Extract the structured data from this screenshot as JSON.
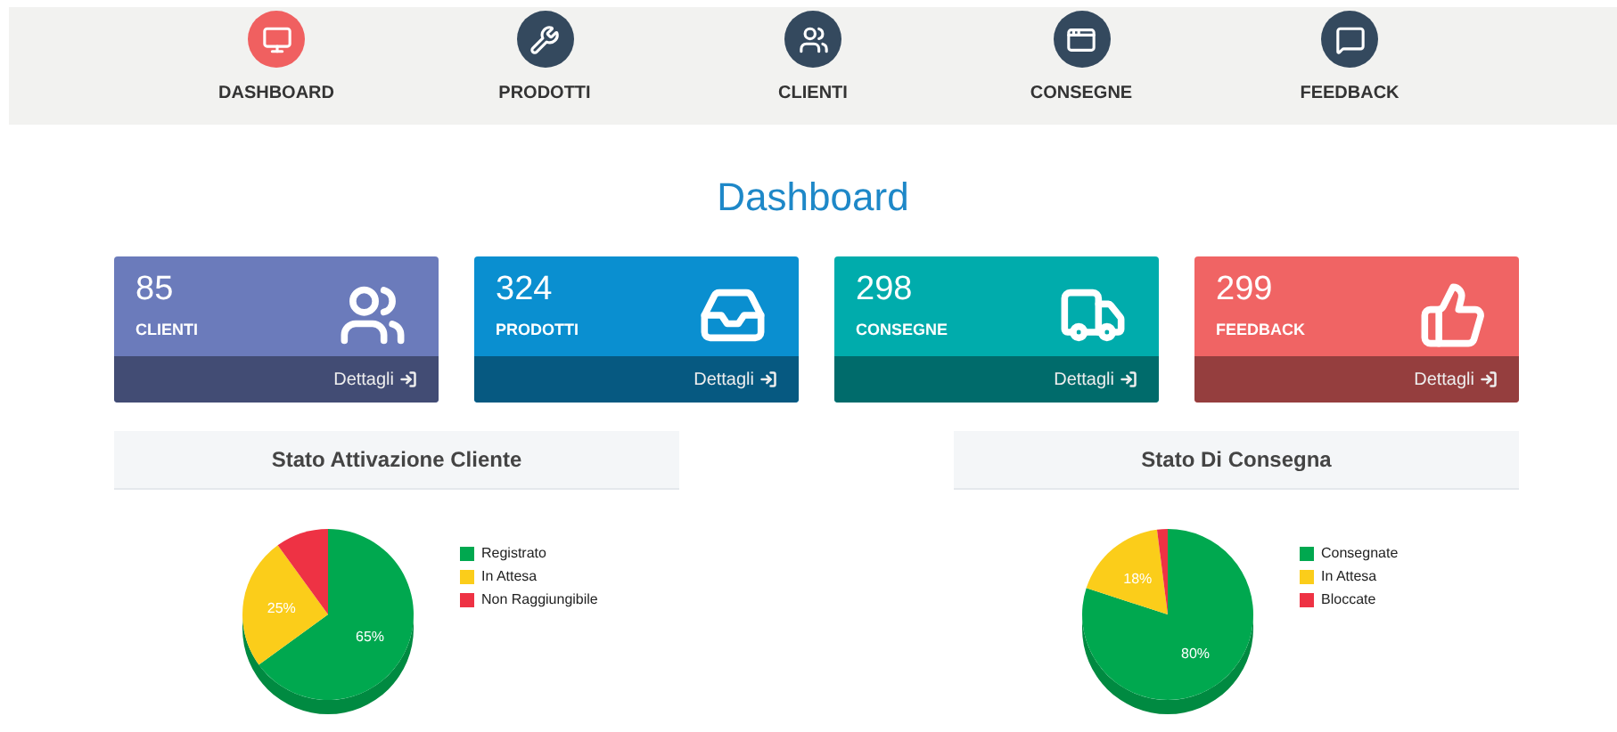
{
  "nav": [
    {
      "label": "DASHBOARD",
      "selected": true,
      "kind": "monitor"
    },
    {
      "label": "PRODOTTI",
      "selected": false,
      "kind": "tools"
    },
    {
      "label": "CLIENTI",
      "selected": false,
      "kind": "people"
    },
    {
      "label": "CONSEGNE",
      "selected": false,
      "kind": "window"
    },
    {
      "label": "FEEDBACK",
      "selected": false,
      "kind": "chat"
    }
  ],
  "title": "Dashboard",
  "cards": [
    {
      "count": "85",
      "label": "CLIENTI",
      "link": "Dettagli",
      "color": "#6b7bbb",
      "kind": "users"
    },
    {
      "count": "324",
      "label": "PRODOTTI",
      "link": "Dettagli",
      "color": "#0a8fd0",
      "kind": "inbox"
    },
    {
      "count": "298",
      "label": "CONSEGNE",
      "link": "Dettagli",
      "color": "#00acac",
      "kind": "truck"
    },
    {
      "count": "299",
      "label": "FEEDBACK",
      "link": "Dettagli",
      "color": "#f06464",
      "kind": "thumb"
    }
  ],
  "panels": [
    {
      "title": "Stato Attivazione Cliente",
      "chart_data": {
        "type": "pie",
        "categories": [
          "Registrato",
          "In Attesa",
          "Non Raggiungibile"
        ],
        "values": [
          65,
          25,
          10
        ],
        "colors": [
          "#00a84f",
          "#fbcd1a",
          "#ee3244"
        ],
        "value_labels": [
          "65%",
          "25%",
          null
        ]
      }
    },
    {
      "title": "Stato Di Consegna",
      "chart_data": {
        "type": "pie",
        "categories": [
          "Consegnate",
          "In Attesa",
          "Bloccate"
        ],
        "values": [
          80,
          18,
          2
        ],
        "colors": [
          "#00a84f",
          "#fbcd1a",
          "#ee3244"
        ],
        "value_labels": [
          "80%",
          "18%",
          null
        ]
      }
    }
  ]
}
